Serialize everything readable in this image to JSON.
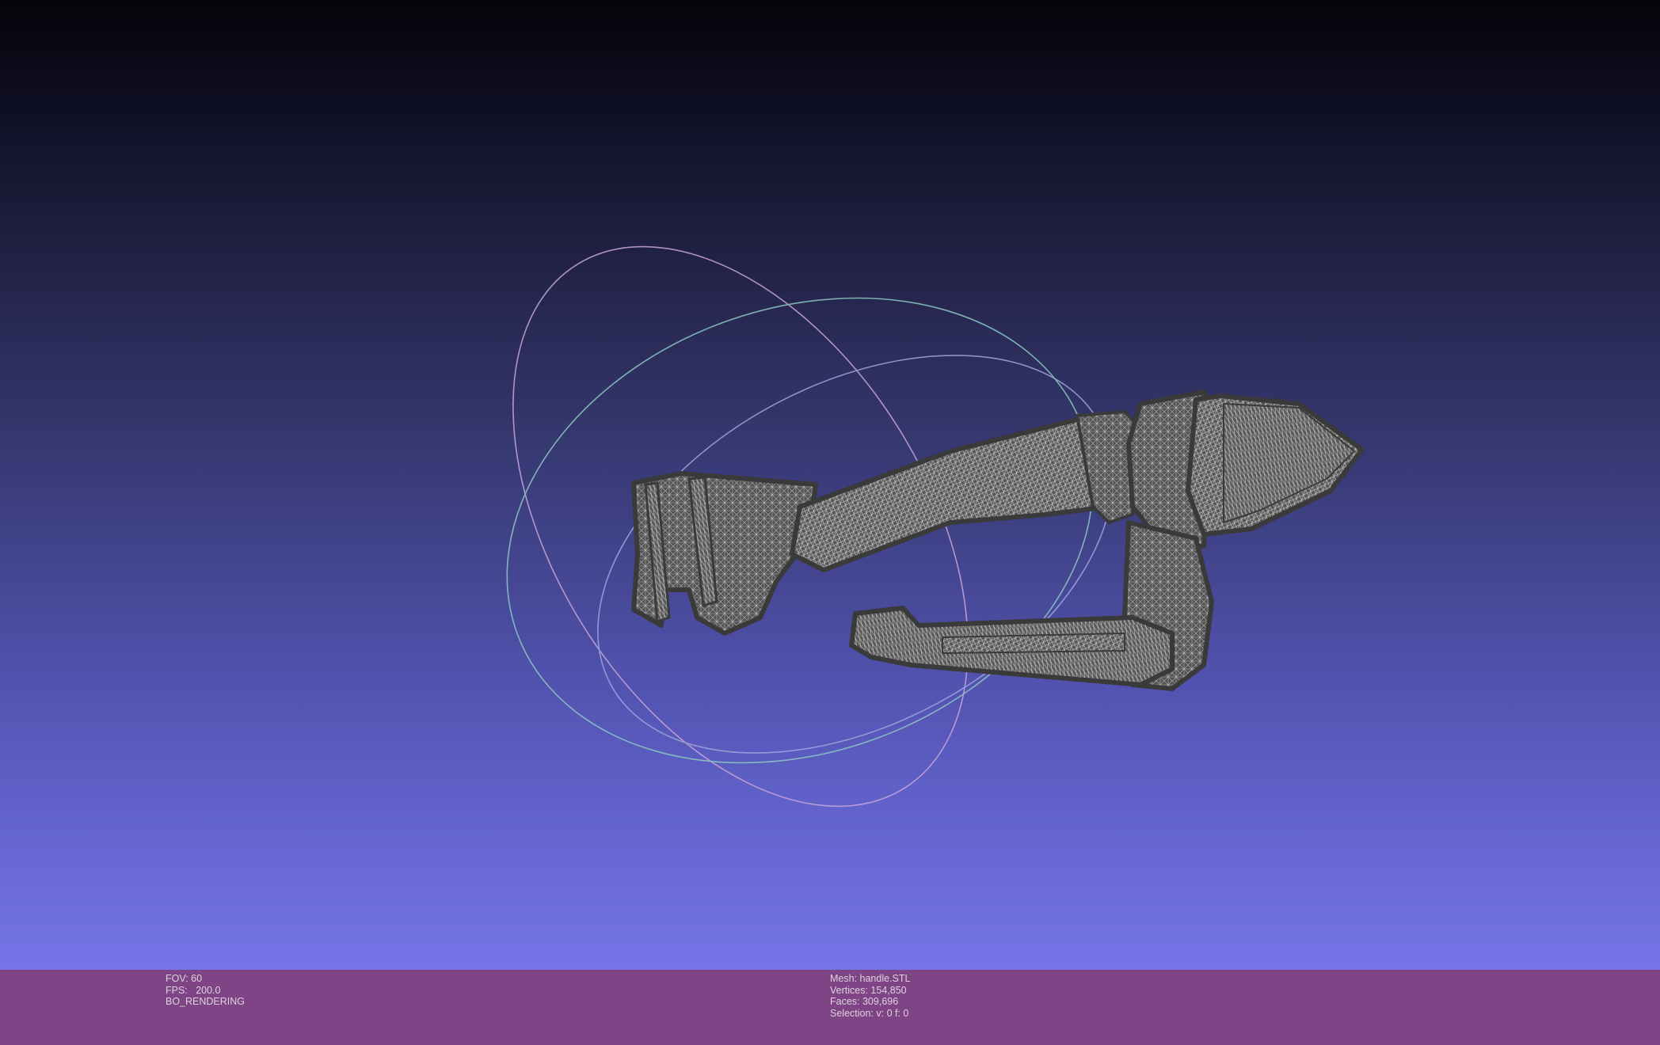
{
  "viewport": {
    "background_top": "#040409",
    "background_bottom": "#7575e8",
    "mesh_color": "#4a4a4a",
    "wire_color": "#c8c8c8",
    "trackball": {
      "ring_colors": [
        "#c9a6d8",
        "#a0a8e0",
        "#8ed0c6"
      ]
    }
  },
  "info_bar": {
    "background": "#7f4485",
    "text_color": "#dcd3de",
    "left": {
      "fov": "FOV: 60",
      "fps": "FPS:   200.0",
      "rendering": "BO_RENDERING"
    },
    "right": {
      "mesh": "Mesh: handle.STL",
      "vertices": "Vertices: 154,850",
      "faces": "Faces: 309,696",
      "selection": "Selection: v: 0 f: 0"
    }
  }
}
